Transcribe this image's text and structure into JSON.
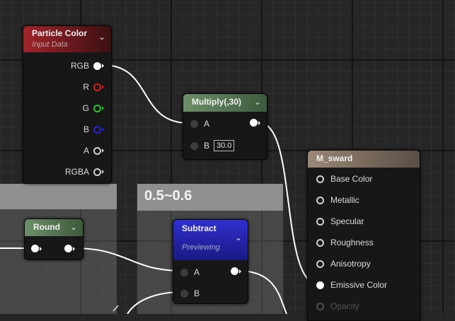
{
  "colors": {
    "particle_header": "#8b1e24",
    "multiply_header": "#5b7a58",
    "round_header": "#5b7a58",
    "subtract_header": "#2626b0",
    "material_header": "#8e7c6e",
    "pin_r": "#d62020",
    "pin_g": "#2ec12e",
    "pin_b": "#2424d8"
  },
  "comment_box": {
    "title": "0.5~0.6"
  },
  "particle_color": {
    "title": "Particle Color",
    "subtitle": "Input Data",
    "outputs": [
      "RGB",
      "R",
      "G",
      "B",
      "A",
      "RGBA"
    ]
  },
  "multiply": {
    "title": "Multiply(,30)",
    "input_a": "A",
    "input_b": "B",
    "b_value": "30.0"
  },
  "round": {
    "title": "Round"
  },
  "subtract": {
    "title": "Subtract",
    "subtitle": "Previewing",
    "input_a": "A",
    "input_b": "B"
  },
  "material": {
    "title": "M_sward",
    "inputs": [
      "Base Color",
      "Metallic",
      "Specular",
      "Roughness",
      "Anisotropy",
      "Emissive Color",
      "Opacity"
    ]
  }
}
